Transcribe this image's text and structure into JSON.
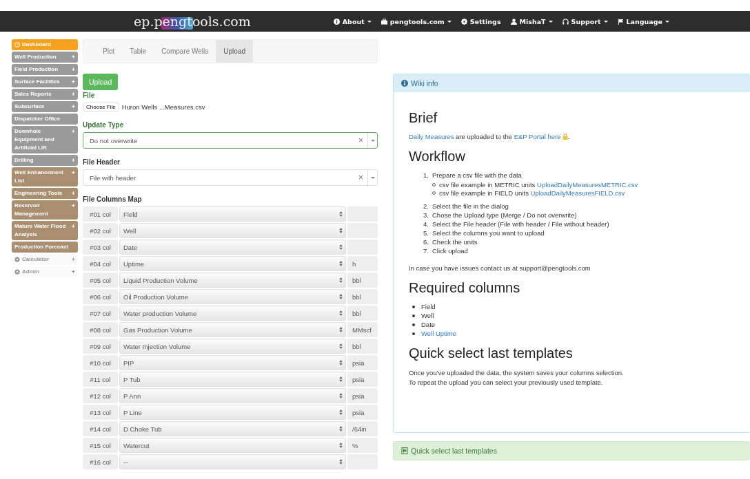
{
  "navbar": {
    "logo": "ep.pengtools.com",
    "items": [
      {
        "label": "About"
      },
      {
        "label": "pengtools.com"
      },
      {
        "label": "Settings",
        "caret": false
      },
      {
        "label": "MishaT"
      },
      {
        "label": "Support"
      },
      {
        "label": "Language"
      }
    ]
  },
  "sidebar": {
    "items": [
      {
        "label": "Dashboard",
        "kind": "active"
      },
      {
        "label": "Well Production",
        "kind": "gray",
        "toggle": "+"
      },
      {
        "label": "Field Production",
        "kind": "gray",
        "toggle": "+"
      },
      {
        "label": "Surface Facilities",
        "kind": "gray",
        "toggle": "+"
      },
      {
        "label": "Sales Reports",
        "kind": "gray",
        "toggle": "+"
      },
      {
        "label": "Subsurface",
        "kind": "gray",
        "toggle": "+"
      },
      {
        "label": "Dispatcher Office",
        "kind": "gray"
      },
      {
        "label": "Downhole Equipment and Artificial Lift",
        "kind": "gray",
        "toggle": "+"
      },
      {
        "label": "Drilling",
        "kind": "gray",
        "toggle": "+"
      },
      {
        "label": "Well Enhancement List",
        "kind": "brown",
        "toggle": "+"
      },
      {
        "label": "Engineering Tools",
        "kind": "brown",
        "toggle": "+"
      },
      {
        "label": "Reservoir Management",
        "kind": "brown",
        "toggle": "+"
      },
      {
        "label": "Mature Water Flood Analysis",
        "kind": "brown",
        "toggle": "+"
      },
      {
        "label": "Production Forecast",
        "kind": "brown"
      },
      {
        "label": "Calculator",
        "kind": "plain",
        "toggle": "+"
      },
      {
        "label": "Admin",
        "kind": "plain",
        "toggle": "+"
      }
    ]
  },
  "tabs": [
    {
      "label": "Plot",
      "selected": false
    },
    {
      "label": "Table",
      "selected": false
    },
    {
      "label": "Compare Wells",
      "selected": false
    },
    {
      "label": "Upload",
      "selected": true
    }
  ],
  "form": {
    "upload_button": "Upload",
    "file_label": "File",
    "choose_file": "Choose File",
    "file_name": "Huron Wells ...Measures.csv",
    "update_type": {
      "label": "Update Type",
      "value": "Do not overwrite",
      "focused": true,
      "clear": "×"
    },
    "file_header": {
      "label": "File Header",
      "value": "File with header",
      "focused": false,
      "clear": "×"
    },
    "map_label": "File Columns Map",
    "columns": [
      {
        "col": "#01 col",
        "field": "Field"
      },
      {
        "col": "#02 col",
        "field": "Well"
      },
      {
        "col": "#03 col",
        "field": "Date"
      },
      {
        "col": "#04 col",
        "field": "Uptime",
        "unit": "h"
      },
      {
        "col": "#05 col",
        "field": "Liquid Production Volume",
        "unit": "bbl"
      },
      {
        "col": "#06 col",
        "field": "Oil Production Volume",
        "unit": "bbl"
      },
      {
        "col": "#07 col",
        "field": "Water production Volume",
        "unit": "bbl"
      },
      {
        "col": "#08 col",
        "field": "Gas Production Volume",
        "unit": "MMscf"
      },
      {
        "col": "#09 col",
        "field": "Water Injection Volume",
        "unit": "bbl"
      },
      {
        "col": "#10 col",
        "field": "PIP",
        "unit": "psia"
      },
      {
        "col": "#11 col",
        "field": "P Tub",
        "unit": "psia"
      },
      {
        "col": "#12 col",
        "field": "P Ann",
        "unit": "psia"
      },
      {
        "col": "#13 col",
        "field": "P Line",
        "unit": "psia"
      },
      {
        "col": "#14 col",
        "field": "D Choke Tub",
        "unit": "/64in"
      },
      {
        "col": "#15 col",
        "field": "Watercut",
        "unit": "%"
      },
      {
        "col": "#16 col",
        "field": "--"
      }
    ]
  },
  "wiki": {
    "title": "Wiki info",
    "brief_heading": "Brief",
    "brief": {
      "link_1": "Daily Measures",
      "text_1": " are uploaded to the ",
      "link_2": "E&P Portal here",
      "text_2": "."
    },
    "workflow_heading": "Workflow",
    "steps": [
      {
        "num": "1.",
        "text": "Prepare a csv file with the data",
        "children": [
          {
            "text": "csv file example in METRIC units ",
            "link": "UploadDailyMeasuresMETRIC.csv"
          },
          {
            "text": "csv file example in FIELD units ",
            "link": "UploadDailyMeasuresFIELD.csv"
          }
        ]
      },
      {
        "num": "2.",
        "text": "Select the file in the dialog"
      },
      {
        "num": "3.",
        "text": "Chose the Upload type (Merge / Do not overwrite)"
      },
      {
        "num": "4.",
        "text": "Select the File header (File with header / File without header)"
      },
      {
        "num": "5.",
        "text": "Select the columns you want to upload"
      },
      {
        "num": "6.",
        "text": "Check the units"
      },
      {
        "num": "7.",
        "text": "Click upload"
      }
    ],
    "contact": "In case you have issues contact us at support@pengtools.com",
    "required_heading": "Required columns",
    "required": [
      {
        "text": "Field",
        "link": false
      },
      {
        "text": "Well",
        "link": false
      },
      {
        "text": "Date",
        "link": false
      },
      {
        "text": "Well Uptime",
        "link": true
      }
    ],
    "quick_heading": "Quick select last templates",
    "quick_text": [
      "Once you've uploaded the data, the system saves your columns selection.",
      "To repeat the upload you can select your previously used template."
    ]
  },
  "templates_panel": {
    "title": "Quick select last templates"
  }
}
